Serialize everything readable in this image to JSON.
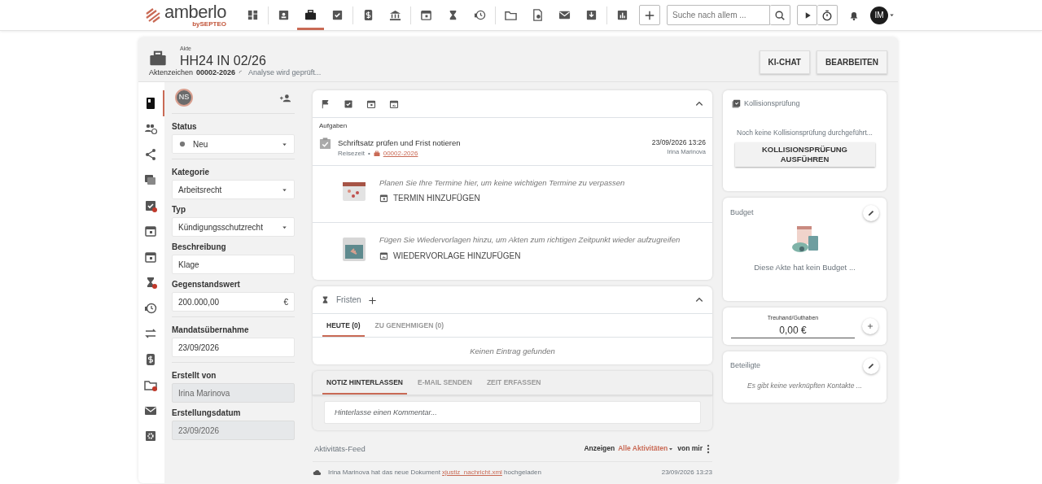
{
  "logo": {
    "name": "amberlo",
    "tagline": "bySEPTEO"
  },
  "nav_groups": [
    [
      {
        "kind": "dashboard",
        "selected": false
      }
    ],
    [
      {
        "kind": "contact",
        "selected": false
      },
      {
        "kind": "briefcase",
        "selected": true
      },
      {
        "kind": "tasks",
        "selected": false
      }
    ],
    [
      {
        "kind": "dollar",
        "selected": false
      },
      {
        "kind": "bank",
        "selected": false
      }
    ],
    [
      {
        "kind": "calendar",
        "selected": false
      },
      {
        "kind": "hourglass",
        "selected": false
      },
      {
        "kind": "moneyclock",
        "selected": false
      }
    ],
    [
      {
        "kind": "folder",
        "selected": false
      },
      {
        "kind": "docsearch",
        "selected": false
      },
      {
        "kind": "mail",
        "selected": false
      },
      {
        "kind": "inbox",
        "selected": false
      }
    ],
    [
      {
        "kind": "chart",
        "selected": false
      }
    ]
  ],
  "search": {
    "placeholder": "Suche nach allem ..."
  },
  "user": {
    "initials": "IM"
  },
  "header": {
    "overline": "Akte",
    "title": "HH24 IN 02/26",
    "ref_label": "Aktenzeichen",
    "ref_value": "00002-2026",
    "analysis": "Analyse wird geprüft...",
    "buttons": [
      "KI-CHAT",
      "BEARBEITEN"
    ]
  },
  "rail": [
    {
      "kind": "book",
      "selected": true,
      "alert": false
    },
    {
      "kind": "people",
      "selected": false,
      "alert": false
    },
    {
      "kind": "share",
      "selected": false,
      "alert": false
    },
    {
      "kind": "docs",
      "selected": false,
      "alert": false
    },
    {
      "kind": "tasks",
      "selected": false,
      "alert": true
    },
    {
      "kind": "calendar",
      "selected": false,
      "alert": false
    },
    {
      "kind": "calendar",
      "selected": false,
      "alert": false
    },
    {
      "kind": "hourglass",
      "selected": false,
      "alert": true
    },
    {
      "kind": "moneyclock",
      "selected": false,
      "alert": false
    },
    {
      "kind": "transfer",
      "selected": false,
      "alert": false
    },
    {
      "kind": "dollar",
      "selected": false,
      "alert": false
    },
    {
      "kind": "folder",
      "selected": false,
      "alert": true
    },
    {
      "kind": "mail",
      "selected": false,
      "alert": false
    },
    {
      "kind": "gear",
      "selected": false,
      "alert": false
    }
  ],
  "owner": {
    "initials": "NS"
  },
  "field_groups": [
    [
      {
        "kind": "status",
        "label": "Status",
        "value": "Neu"
      }
    ],
    [
      {
        "kind": "select",
        "label": "Kategorie",
        "value": "Arbeitsrecht"
      },
      {
        "kind": "select",
        "label": "Typ",
        "value": "Kündigungsschutzrecht"
      },
      {
        "kind": "input",
        "label": "Beschreibung",
        "value": "Klage"
      },
      {
        "kind": "money",
        "label": "Gegenstandswert",
        "value": "200.000,00",
        "suffix": "€"
      }
    ],
    [
      {
        "kind": "input",
        "label": "Mandatsübernahme",
        "value": "23/09/2026"
      }
    ],
    [
      {
        "kind": "readonly",
        "label": "Erstellt von",
        "value": "Irina Marinova"
      },
      {
        "kind": "readonly",
        "label": "Erstellungsdatum",
        "value": "23/09/2026"
      }
    ]
  ],
  "activity_tabs": [
    {
      "kind": "flag"
    },
    {
      "kind": "tasks"
    },
    {
      "kind": "calendar"
    },
    {
      "kind": "calback"
    }
  ],
  "tasks": {
    "heading": "Aufgaben",
    "items": [
      {
        "title": "Schriftsatz prüfen und Frist notieren",
        "category": "Reisezeit",
        "separator": "•",
        "case": "00002-2026",
        "date": "23/09/2026 13:26",
        "user": "Irina Marinova"
      }
    ]
  },
  "empty_states": [
    {
      "kind": "calendar",
      "hint": "Planen Sie Ihre Termine hier, um keine wichtigen Termine zu verpassen",
      "action": "TERMIN HINZUFÜGEN"
    },
    {
      "kind": "calback",
      "hint": "Fügen Sie Wiedervorlagen hinzu, um Akten zum richtigen Zeitpunkt wieder aufzugreifen",
      "action": "WIEDERVORLAGE HINZUFÜGEN"
    }
  ],
  "deadlines": {
    "title": "Fristen",
    "tabs": [
      {
        "label": "HEUTE (0)",
        "selected": true
      },
      {
        "label": "ZU GENEHMIGEN (0)",
        "selected": false
      }
    ],
    "empty": "Keinen Eintrag gefunden"
  },
  "composer": {
    "tabs": [
      {
        "label": "NOTIZ HINTERLASSEN",
        "selected": true
      },
      {
        "label": "E-MAIL SENDEN",
        "selected": false
      },
      {
        "label": "ZEIT ERFASSEN",
        "selected": false
      }
    ],
    "placeholder": "Hinterlasse einen Kommentar..."
  },
  "feed": {
    "title": "Aktivitäts-Feed",
    "show_label": "Anzeigen",
    "filter": "Alle Aktivitäten",
    "scope": "von mir",
    "entries": [
      {
        "before": "Irina Marinova hat das neue Dokument ",
        "link": "xjustiz_nachricht.xml",
        "after": " hochgeladen",
        "date": "23/09/2026 13:23"
      }
    ]
  },
  "conflict": {
    "title": "Kollisionsprüfung",
    "message": "Noch keine Kollisionsprüfung durchgeführt...",
    "button": "KOLLISIONSPRÜFUNG AUSFÜHREN"
  },
  "budget": {
    "title": "Budget",
    "message": "Diese Akte hat kein Budget ..."
  },
  "trust": {
    "label": "Treuhand/Guthaben",
    "value": "0,00 €"
  },
  "parties": {
    "title": "Beteiligte",
    "message": "Es gibt keine verknüpften Kontakte ..."
  }
}
